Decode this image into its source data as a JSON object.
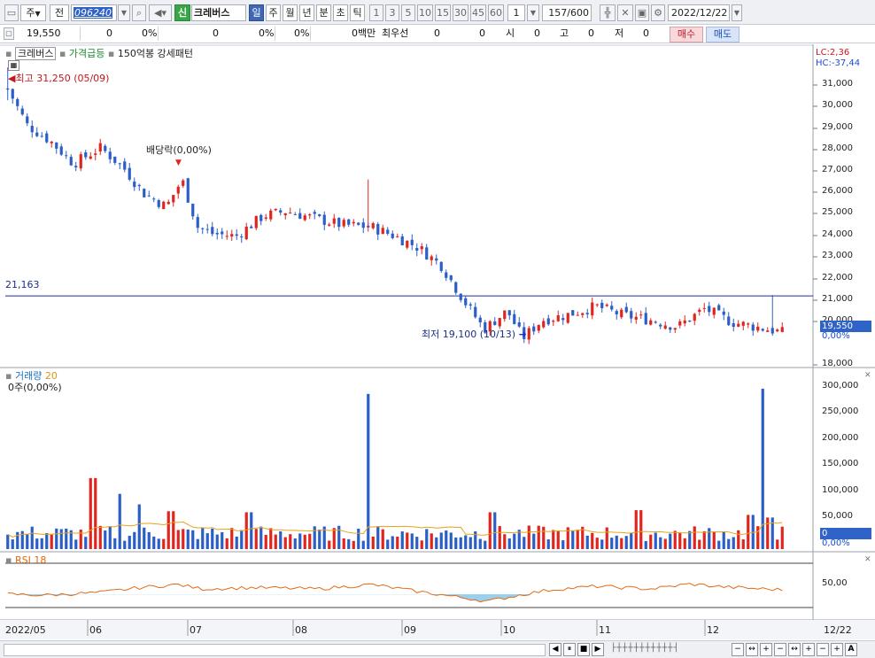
{
  "toolbar": {
    "period": "주",
    "market": "전",
    "code": "096240",
    "badge": "신",
    "stock_name": "크레버스",
    "tabs": [
      "일",
      "주",
      "월",
      "년",
      "분",
      "초",
      "틱"
    ],
    "active_tab": "일",
    "minute_options": [
      "1",
      "3",
      "5",
      "10",
      "15",
      "30",
      "45",
      "60"
    ],
    "count_select": "1",
    "range": "157",
    "range_total": "/600",
    "date": "2022/12/22"
  },
  "quote": {
    "price": "19,550",
    "change": "0",
    "change_rate": "0%",
    "prev": "0",
    "prev_rate": "0%",
    "extra_rate": "0%",
    "volume": "0백만",
    "priority_label": "최우선",
    "bid": "0",
    "ask": "0",
    "open_label": "시",
    "open": "0",
    "high_label": "고",
    "high": "0",
    "low_label": "저",
    "low": "0",
    "buy_label": "매수",
    "sell_label": "매도"
  },
  "price_panel": {
    "legend": [
      "크레버스",
      "가격급등",
      "150억봉 강세패턴"
    ],
    "lc": "LC:2,36",
    "hc": "HC:-37,44",
    "high_note": "최고 31,250 (05/09)",
    "low_note": "최저 19,100 (10/13)",
    "dividend_note": "배당락(0,00%)",
    "hline_label": "21,163",
    "current_badge": "19,550",
    "current_pct": "0,00%",
    "yticks": [
      "31,000",
      "30,000",
      "29,000",
      "28,000",
      "27,000",
      "26,000",
      "25,000",
      "24,000",
      "23,000",
      "22,000",
      "21,000",
      "20,000",
      "18,000"
    ]
  },
  "volume_panel": {
    "title": "거래량",
    "period": "20",
    "value": "0주(0,00%)",
    "current_badge": "0",
    "current_pct": "0,00%",
    "yticks": [
      "300,000",
      "250,000",
      "200,000",
      "150,000",
      "100,000",
      "50,000"
    ]
  },
  "rsi_panel": {
    "title": "RSI 18",
    "ytick": "50,00"
  },
  "xaxis": {
    "labels": [
      "2022/05",
      "06",
      "07",
      "08",
      "09",
      "10",
      "11",
      "12"
    ],
    "right_label": "12/22"
  },
  "colors": {
    "up": "#e0251f",
    "down": "#2a5fc7",
    "ma": "#e8a21a",
    "rsi": "#e06a16",
    "hline": "#1f2a9e",
    "badge": "#2f63c8"
  },
  "chart_data": {
    "type": "candlestick",
    "x_start": "2022-05-02",
    "x_end": "2022-12-22",
    "ylim": [
      18000,
      31800
    ],
    "hline": 21163,
    "high_point": {
      "date": "05/09",
      "value": 31250
    },
    "low_point": {
      "date": "10/13",
      "value": 19100
    },
    "close_anchors": [
      {
        "pos": 0.0,
        "v": 30300
      },
      {
        "pos": 0.025,
        "v": 28700
      },
      {
        "pos": 0.055,
        "v": 28000
      },
      {
        "pos": 0.085,
        "v": 27000
      },
      {
        "pos": 0.12,
        "v": 27700
      },
      {
        "pos": 0.15,
        "v": 26800
      },
      {
        "pos": 0.175,
        "v": 25700
      },
      {
        "pos": 0.205,
        "v": 25100
      },
      {
        "pos": 0.225,
        "v": 26300
      },
      {
        "pos": 0.245,
        "v": 24200
      },
      {
        "pos": 0.265,
        "v": 23900
      },
      {
        "pos": 0.295,
        "v": 23800
      },
      {
        "pos": 0.33,
        "v": 24700
      },
      {
        "pos": 0.36,
        "v": 24900
      },
      {
        "pos": 0.395,
        "v": 24600
      },
      {
        "pos": 0.43,
        "v": 24300
      },
      {
        "pos": 0.47,
        "v": 24200
      },
      {
        "pos": 0.5,
        "v": 23800
      },
      {
        "pos": 0.53,
        "v": 23300
      },
      {
        "pos": 0.56,
        "v": 22500
      },
      {
        "pos": 0.59,
        "v": 20900
      },
      {
        "pos": 0.615,
        "v": 19700
      },
      {
        "pos": 0.645,
        "v": 20500
      },
      {
        "pos": 0.665,
        "v": 19300
      },
      {
        "pos": 0.69,
        "v": 20100
      },
      {
        "pos": 0.72,
        "v": 20300
      },
      {
        "pos": 0.76,
        "v": 20700
      },
      {
        "pos": 0.795,
        "v": 20300
      },
      {
        "pos": 0.83,
        "v": 20100
      },
      {
        "pos": 0.865,
        "v": 19800
      },
      {
        "pos": 0.9,
        "v": 20600
      },
      {
        "pos": 0.935,
        "v": 20000
      },
      {
        "pos": 0.965,
        "v": 19800
      },
      {
        "pos": 1.0,
        "v": 19550
      }
    ],
    "volume_ylim": [
      0,
      320000
    ],
    "volume_spikes": [
      {
        "pos": 0.11,
        "v": 135000
      },
      {
        "pos": 0.145,
        "v": 105000
      },
      {
        "pos": 0.17,
        "v": 85000
      },
      {
        "pos": 0.21,
        "v": 72000
      },
      {
        "pos": 0.31,
        "v": 70000
      },
      {
        "pos": 0.465,
        "v": 295000
      },
      {
        "pos": 0.625,
        "v": 70000
      },
      {
        "pos": 0.815,
        "v": 74000
      },
      {
        "pos": 0.96,
        "v": 65000
      },
      {
        "pos": 0.975,
        "v": 305000
      },
      {
        "pos": 0.985,
        "v": 60000
      }
    ],
    "rsi_ylim": [
      0,
      100
    ],
    "rsi_anchors": [
      {
        "pos": 0.0,
        "v": 30
      },
      {
        "pos": 0.05,
        "v": 28
      },
      {
        "pos": 0.12,
        "v": 34
      },
      {
        "pos": 0.17,
        "v": 45
      },
      {
        "pos": 0.22,
        "v": 52
      },
      {
        "pos": 0.25,
        "v": 42
      },
      {
        "pos": 0.32,
        "v": 45
      },
      {
        "pos": 0.4,
        "v": 42
      },
      {
        "pos": 0.47,
        "v": 52
      },
      {
        "pos": 0.53,
        "v": 36
      },
      {
        "pos": 0.58,
        "v": 24
      },
      {
        "pos": 0.62,
        "v": 14
      },
      {
        "pos": 0.66,
        "v": 28
      },
      {
        "pos": 0.7,
        "v": 40
      },
      {
        "pos": 0.76,
        "v": 48
      },
      {
        "pos": 0.83,
        "v": 42
      },
      {
        "pos": 0.88,
        "v": 53
      },
      {
        "pos": 0.93,
        "v": 46
      },
      {
        "pos": 1.0,
        "v": 40
      }
    ]
  }
}
